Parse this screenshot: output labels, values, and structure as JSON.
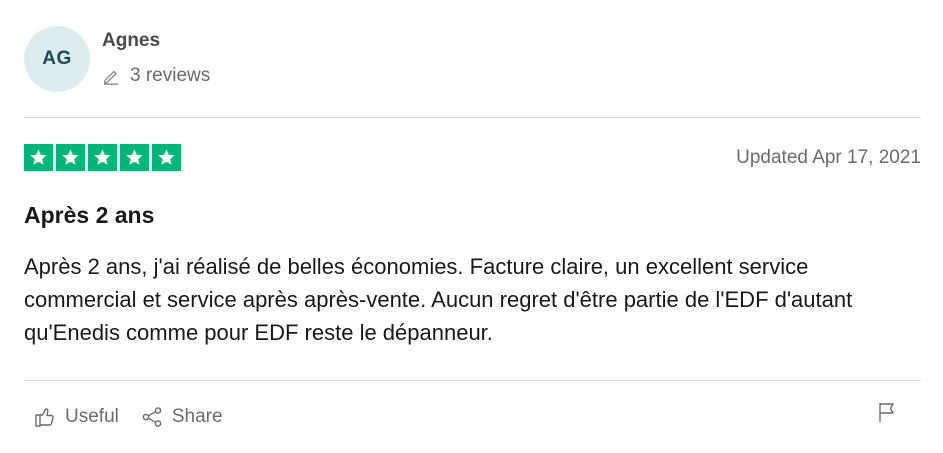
{
  "reviewer": {
    "initials": "AG",
    "name": "Agnes",
    "reviews_count": "3 reviews"
  },
  "rating": {
    "stars": 5,
    "max": 5,
    "color": "#00b67a"
  },
  "date": "Updated Apr 17, 2021",
  "review": {
    "title": "Après 2 ans",
    "body": "Après 2 ans, j'ai réalisé de belles économies. Facture claire, un excellent service commercial et service après après-vente. Aucun regret d'être partie de l'EDF d'autant qu'Enedis comme pour EDF reste le dépanneur."
  },
  "actions": {
    "useful_label": "Useful",
    "share_label": "Share"
  },
  "icons": {
    "reviews": "pencil-icon",
    "useful": "thumbs-up-icon",
    "share": "share-icon",
    "report": "flag-icon"
  }
}
